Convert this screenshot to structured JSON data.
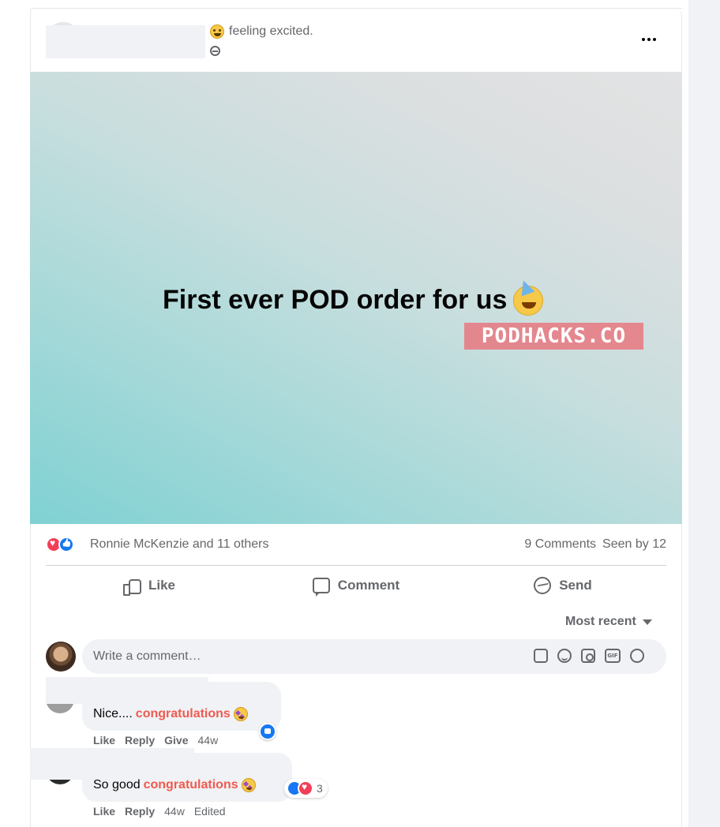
{
  "post": {
    "feeling": "feeling excited.",
    "banner_text": "First ever POD order for us",
    "watermark": "PODHACKS.CO"
  },
  "reactions": {
    "names": "Ronnie McKenzie and 11 others",
    "comments": "9 Comments",
    "seen": "Seen by 12"
  },
  "actions": {
    "like": "Like",
    "comment": "Comment",
    "send": "Send"
  },
  "sort": "Most recent",
  "composer": {
    "placeholder": "Write a comment…",
    "icons": [
      "sticker-icon",
      "emoji-icon",
      "camera-icon",
      "gif-icon",
      "avatar-sticker-icon"
    ],
    "gif_label": "GIF"
  },
  "comments": [
    {
      "text": "Nice....",
      "highlight": "congratulations",
      "meta": {
        "like": "Like",
        "reply": "Reply",
        "give": "Give",
        "time": "44w"
      }
    },
    {
      "text": "So good",
      "highlight": "congratulations",
      "reaction_count": "3",
      "meta": {
        "like": "Like",
        "reply": "Reply",
        "time": "44w",
        "edited": "Edited"
      }
    }
  ],
  "colors": {
    "highlight": "#f05a4f",
    "like_blue": "#1877f2",
    "love_red": "#f33e58",
    "watermark_bg": "#e87880"
  }
}
